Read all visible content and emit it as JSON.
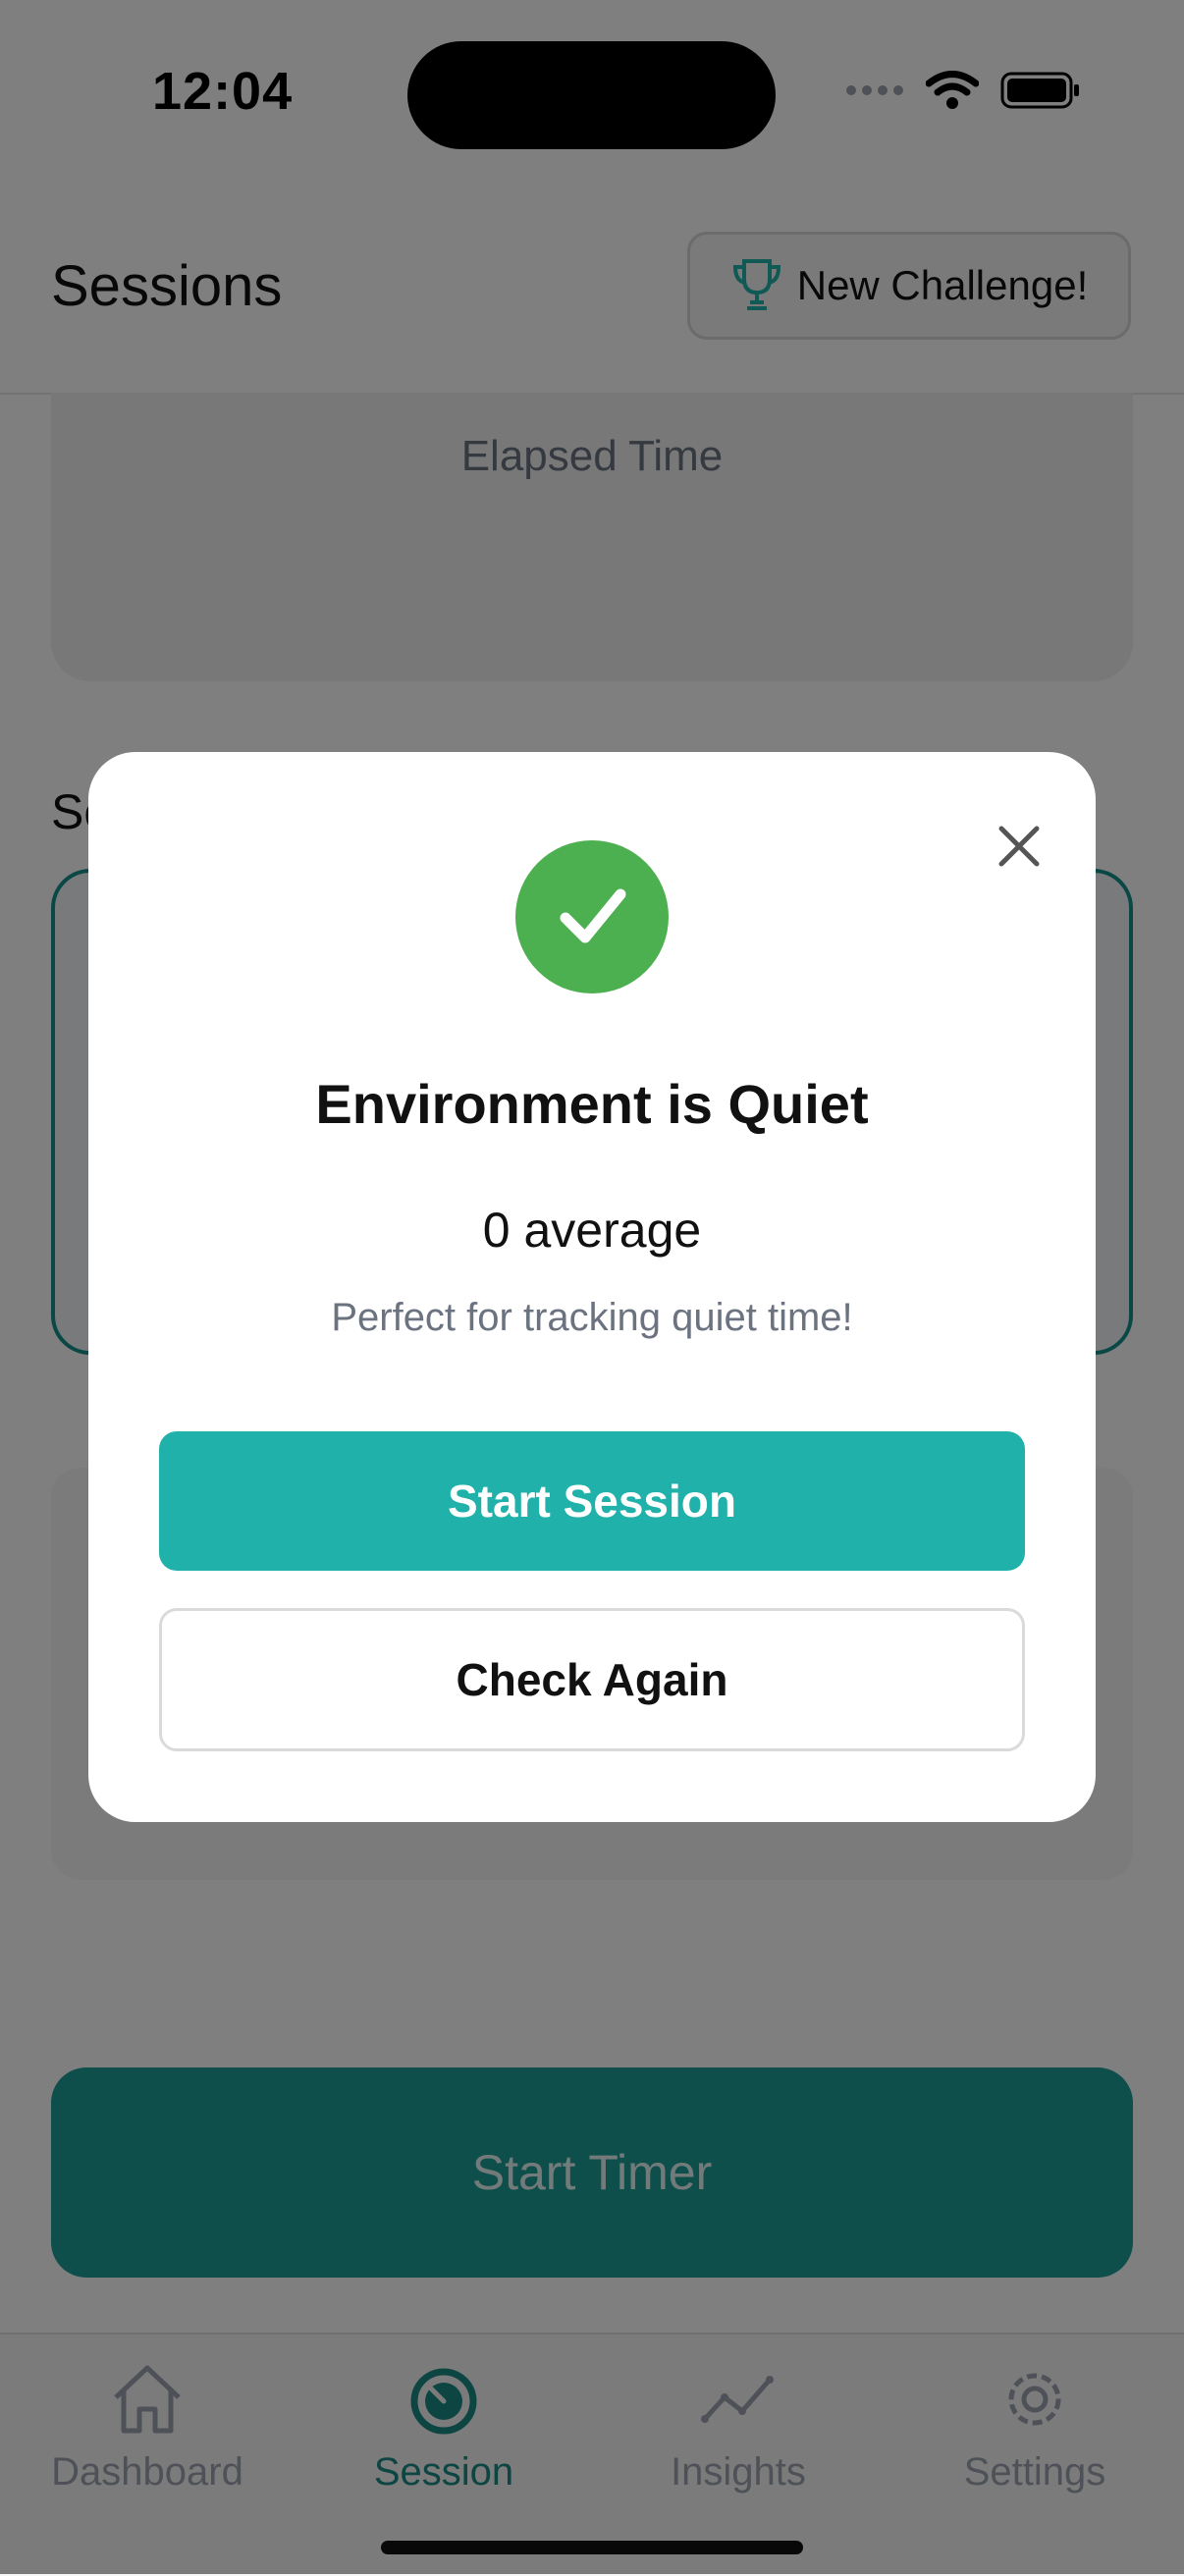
{
  "status_bar": {
    "time": "12:04"
  },
  "header": {
    "title": "Sessions",
    "challenge_button": {
      "label": "New Challenge!",
      "icon": "trophy-icon"
    }
  },
  "timer_card": {
    "label": "Elapsed Time"
  },
  "section": {
    "title_partial": "Se"
  },
  "start_timer_label": "Start Timer",
  "tabs": [
    {
      "label": "Dashboard",
      "icon": "home-icon",
      "active": false
    },
    {
      "label": "Session",
      "icon": "timer-icon",
      "active": true
    },
    {
      "label": "Insights",
      "icon": "chart-line-icon",
      "active": false
    },
    {
      "label": "Settings",
      "icon": "gear-icon",
      "active": false
    }
  ],
  "modal": {
    "title": "Environment is Quiet",
    "value": "0 average",
    "subtitle": "Perfect for tracking quiet time!",
    "primary_button": "Start Session",
    "secondary_button": "Check Again",
    "status_icon": "check-circle-icon"
  },
  "colors": {
    "accent": "#20B2AA",
    "success": "#4CB050",
    "tab_active": "#1A8A84"
  }
}
